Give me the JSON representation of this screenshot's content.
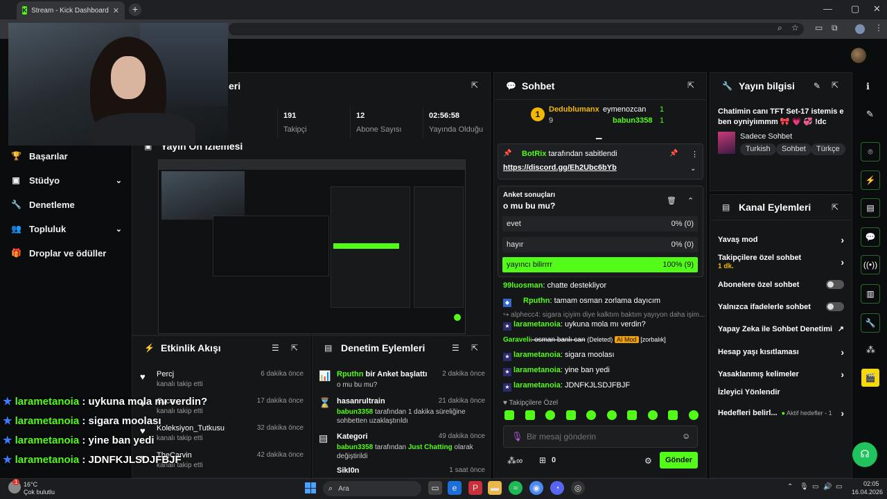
{
  "browser": {
    "tab_title": "Stream - Kick Dashboard",
    "tab_close": "✕",
    "new_tab": "+",
    "window_controls": [
      "—",
      "▢",
      "✕"
    ]
  },
  "nav": {
    "items": [
      {
        "label": "Başarılar",
        "icon": "trophy-icon",
        "glyph": "🏆",
        "chevron": ""
      },
      {
        "label": "Stüdyo",
        "icon": "film-icon",
        "glyph": "▣",
        "chevron": "⌄"
      },
      {
        "label": "Denetleme",
        "icon": "wrench-icon",
        "glyph": "🔧",
        "chevron": ""
      },
      {
        "label": "Topluluk",
        "icon": "users-icon",
        "glyph": "👥",
        "chevron": "⌄"
      },
      {
        "label": "Droplar ve ödüller",
        "icon": "gift-icon",
        "glyph": "🎁",
        "chevron": ""
      }
    ]
  },
  "stream_panel": {
    "title_fragment": "eri",
    "preview_title": "Yayın Ön İzlemesi",
    "stats": [
      {
        "value": "",
        "label": "ci"
      },
      {
        "value": "191",
        "label": "Takipçi"
      },
      {
        "value": "12",
        "label": "Abone Sayısı"
      },
      {
        "value": "02:56:58",
        "label": "Yayında Olduğu"
      }
    ]
  },
  "activity": {
    "title": "Etkinlik Akışı",
    "items": [
      {
        "name": "Percj",
        "sub": "kanalı takip etti",
        "time": "6 dakika önce"
      },
      {
        "name": "Cyco...",
        "sub": "kanalı takip etti",
        "time": "17 dakika önce"
      },
      {
        "name": "Koleksiyon_Tutkusu",
        "sub": "kanalı takip etti",
        "time": "32 dakika önce"
      },
      {
        "name": "TheCarvin",
        "sub": "kanalı takip etti",
        "time": "42 dakika önce"
      }
    ]
  },
  "mod_actions": {
    "title": "Denetim Eylemleri",
    "items": [
      {
        "icon": "📊",
        "user": "Rputhn",
        "text": " bir Anket başlattı",
        "sub": "o mu bu mu?",
        "time": "2 dakika önce"
      },
      {
        "icon": "⌛",
        "user": "",
        "text": "hasanrultrain",
        "sub_user": "babun3358",
        "sub": " tarafından 1 dakika süreliğine sohbetten uzaklaştırıldı",
        "time": "21 dakika önce"
      },
      {
        "icon": "▤",
        "user": "",
        "text": "Kategori",
        "sub_user": "babun3358",
        "sub_mid": " tarafından ",
        "sub_cat": "Just Chatting",
        "sub": " olarak değiştirildi",
        "time": "49 dakika önce"
      },
      {
        "icon": "",
        "user": "",
        "text": "SikI0n",
        "sub": "",
        "time": "1 saat önce"
      }
    ]
  },
  "chat": {
    "title": "Sohbet",
    "top_gifters": [
      {
        "rank": "1",
        "name": "Dedublumanx",
        "count": "9"
      },
      {
        "name": "eymenozcan",
        "count": "1"
      },
      {
        "name": "babun3358",
        "count": "1"
      }
    ],
    "pinned": {
      "by_user": "BotRix",
      "by_text": " tarafından sabitlendi",
      "link": "https://discord.gg/Eh2Ubc6bYb"
    },
    "poll": {
      "header": "Anket sonuçları",
      "question": "o mu bu mu?",
      "options": [
        {
          "label": "evet",
          "result": "0% (0)",
          "fill": 0
        },
        {
          "label": "hayır",
          "result": "0% (0)",
          "fill": 0
        },
        {
          "label": "yayıncı bilirrrr",
          "result": "100% (9)",
          "fill": 100
        }
      ]
    },
    "messages": [
      {
        "user": "99luosman",
        "text": ": chatte destekliyor",
        "badge": ""
      },
      {
        "user": "Rputhn",
        "text": ": tamam osman zorlama dayıcım",
        "badge": "◆"
      },
      {
        "user": "",
        "text": "alphecc4: sigara içiyim diye kalktım baktım yayıyon daha işim...",
        "badge": "",
        "reply": true
      },
      {
        "user": "larametanoia",
        "text": ": uykuna mola mı verdin?",
        "badge": "★"
      },
      {
        "user": "Garaveli",
        "text": ": osman banlı can",
        "badge": "",
        "deleted": "(Deleted)",
        "ai": "AI Mod",
        "tag": "[zorbalık]"
      },
      {
        "user": "larametanoia",
        "text": ": sigara moolası",
        "badge": "★"
      },
      {
        "user": "larametanoia",
        "text": ": yine ban yedi",
        "badge": "★"
      },
      {
        "user": "larametanoia",
        "text": ": JDNFKJLSDJFBJF",
        "badge": "★"
      }
    ],
    "followers_only": "Takipçilere Özel",
    "input_placeholder": "Bir mesaj gönderin",
    "points": "0",
    "send_label": "Gönder"
  },
  "stream_info": {
    "title": "Yayın bilgisi",
    "stream_title": "Chatimin canı TFT Set-17 istemis e ben oyniyiımmm 🎀 💗 💞 !dc",
    "category": "Sadece Sohbet",
    "tags": [
      "Turkish",
      "Sohbet",
      "Türkçe"
    ]
  },
  "channel_actions": {
    "title": "Kanal Eylemleri",
    "rows": [
      {
        "label": "Yavaş mod",
        "control": "chevron"
      },
      {
        "label": "Takipçilere özel sohbet",
        "sub": "1 dk.",
        "control": "chevron"
      },
      {
        "label": "Abonelere özel sohbet",
        "control": "toggle"
      },
      {
        "label": "Yalnızca ifadelerle sohbet",
        "control": "toggle"
      },
      {
        "label": "Yapay Zeka ile Sohbet Denetimi",
        "control": "external"
      },
      {
        "label": "Hesap yaşı kısıtlaması",
        "control": "chevron"
      },
      {
        "label": "Yasaklanmış kelimeler",
        "control": "chevron"
      },
      {
        "label": "İzleyici Yönlendir",
        "control": "none"
      },
      {
        "label": "Hedefleri belirl...",
        "sub": "Aktif hedefler - 1",
        "control": "chevron"
      }
    ]
  },
  "overlay_chat": [
    {
      "user": "larametanoia",
      "text": " : uykuna mola mı verdin?"
    },
    {
      "user": "larametanoia",
      "text": " : sigara moolası"
    },
    {
      "user": "larametanoia",
      "text": " : yine ban yedi"
    },
    {
      "user": "larametanoia",
      "text": " : JDNFKJLSDJFBJF"
    }
  ],
  "taskbar": {
    "weather_temp": "16°C",
    "weather_text": "Çok bulutlu",
    "weather_badge": "1",
    "search_placeholder": "Ara",
    "time": "02:05",
    "date": "16.04.2026"
  },
  "colors": {
    "accent": "#53fc18",
    "background": "#0b0c0d",
    "panel": "#151617"
  }
}
